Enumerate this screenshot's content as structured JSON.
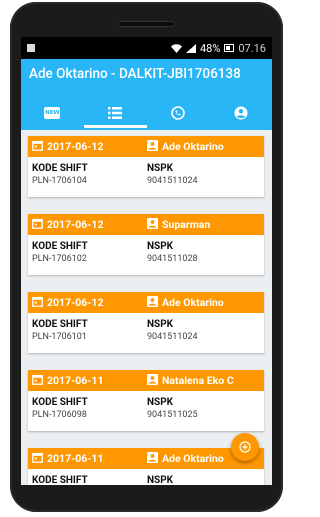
{
  "status": {
    "battery_pct": "48%",
    "time": "07.16"
  },
  "appbar": {
    "title": "Ade Oktarino - DALKIT-JBI1706138"
  },
  "tabs": [
    {
      "name": "new",
      "icon": "new-badge-icon",
      "badge_text": "NEW",
      "active": false
    },
    {
      "name": "list",
      "icon": "list-icon",
      "active": true
    },
    {
      "name": "calls",
      "icon": "phone-in-circle-icon",
      "active": false
    },
    {
      "name": "profile",
      "icon": "account-circle-icon",
      "active": false
    }
  ],
  "columns": {
    "left_label": "KODE SHIFT",
    "right_label": "NSPK"
  },
  "cards": [
    {
      "date": "2017-06-12",
      "name": "Ade Oktarino",
      "kode_shift": "PLN-1706104",
      "nspk": "9041511024"
    },
    {
      "date": "2017-06-12",
      "name": "Suparman",
      "kode_shift": "PLN-1706102",
      "nspk": "9041511028"
    },
    {
      "date": "2017-06-12",
      "name": "Ade Oktarino",
      "kode_shift": "PLN-1706101",
      "nspk": "9041511024"
    },
    {
      "date": "2017-06-11",
      "name": "Natalena Eko C",
      "kode_shift": "PLN-1706098",
      "nspk": "9041511025"
    },
    {
      "date": "2017-06-11",
      "name": "Ade Oktarino",
      "kode_shift": "",
      "nspk": ""
    }
  ],
  "colors": {
    "app_bar": "#29b6f6",
    "card_header": "#ff9800",
    "fab": "#ff9800"
  }
}
